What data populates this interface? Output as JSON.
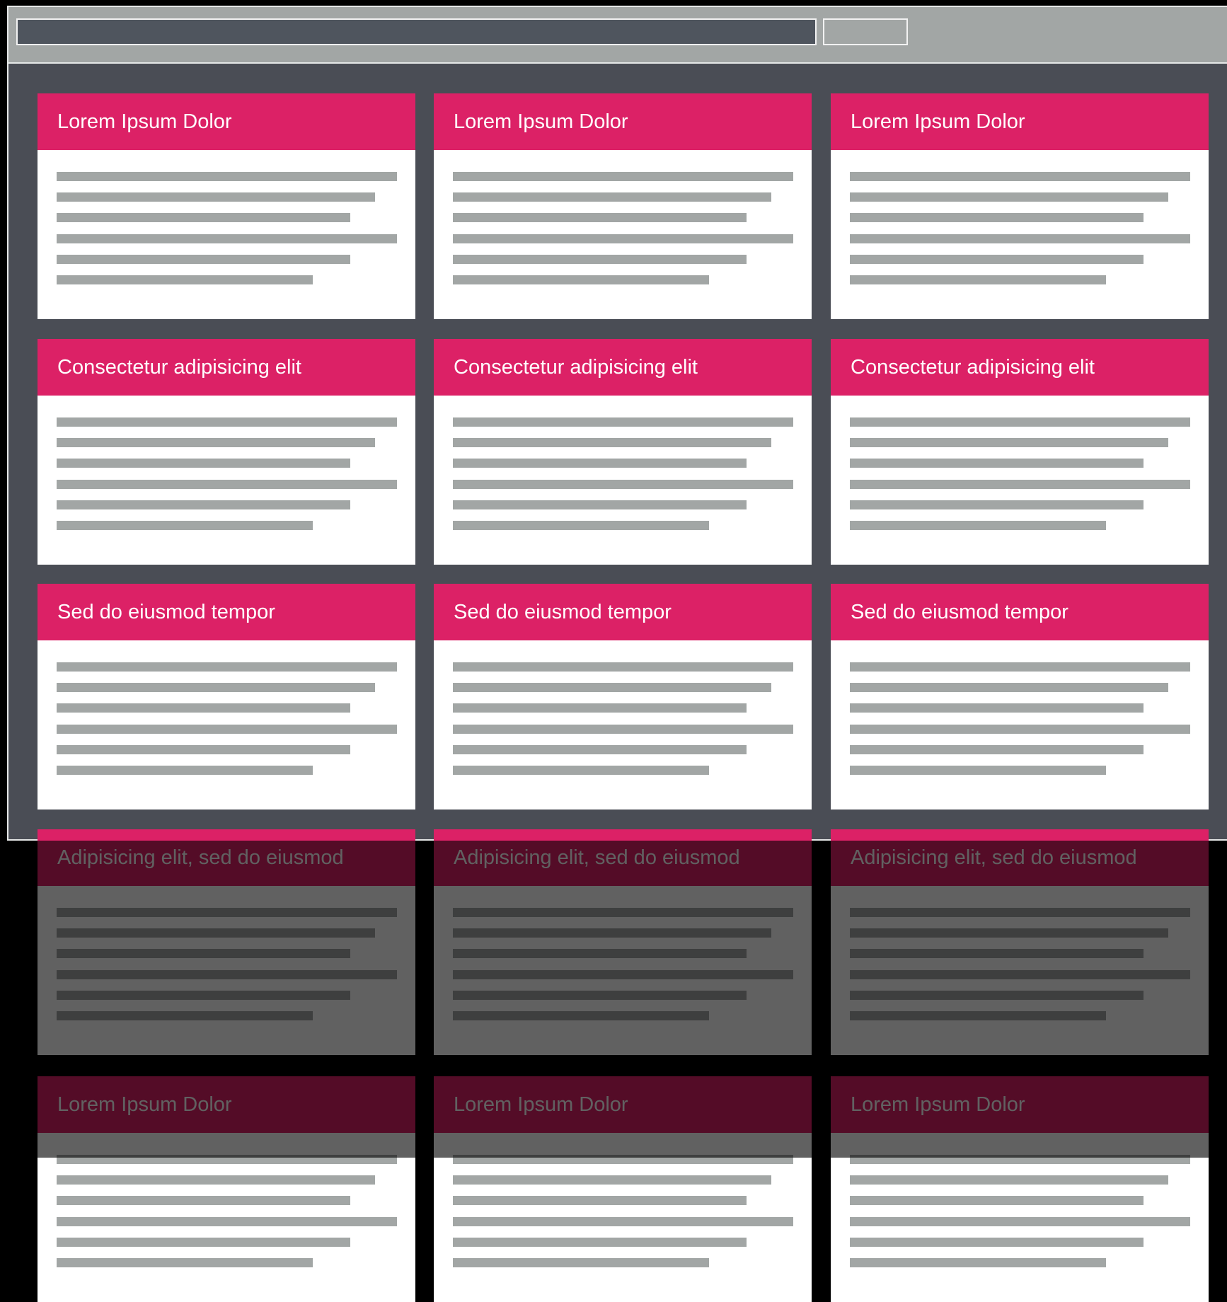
{
  "colors": {
    "page_background": "#000000",
    "window_background": "#4a4d55",
    "toolbar_background": "#a2a6a5",
    "address_bar_fill": "#4f555e",
    "card_header": "#dc2166",
    "card_body": "#ffffff",
    "placeholder_text_lines": "#a2a6a5"
  },
  "cards": [
    {
      "title": "Lorem Ipsum Dolor"
    },
    {
      "title": "Lorem Ipsum Dolor"
    },
    {
      "title": "Lorem Ipsum Dolor"
    },
    {
      "title": "Consectetur adipisicing elit"
    },
    {
      "title": "Consectetur adipisicing elit"
    },
    {
      "title": "Consectetur adipisicing elit"
    },
    {
      "title": "Sed do eiusmod tempor"
    },
    {
      "title": "Sed do eiusmod tempor"
    },
    {
      "title": "Sed do eiusmod tempor"
    },
    {
      "title": "Adipisicing elit, sed do eiusmod"
    },
    {
      "title": "Adipisicing elit, sed do eiusmod"
    },
    {
      "title": "Adipisicing elit, sed do eiusmod"
    },
    {
      "title": "Lorem Ipsum Dolor"
    },
    {
      "title": "Lorem Ipsum Dolor"
    },
    {
      "title": "Lorem Ipsum Dolor"
    }
  ]
}
